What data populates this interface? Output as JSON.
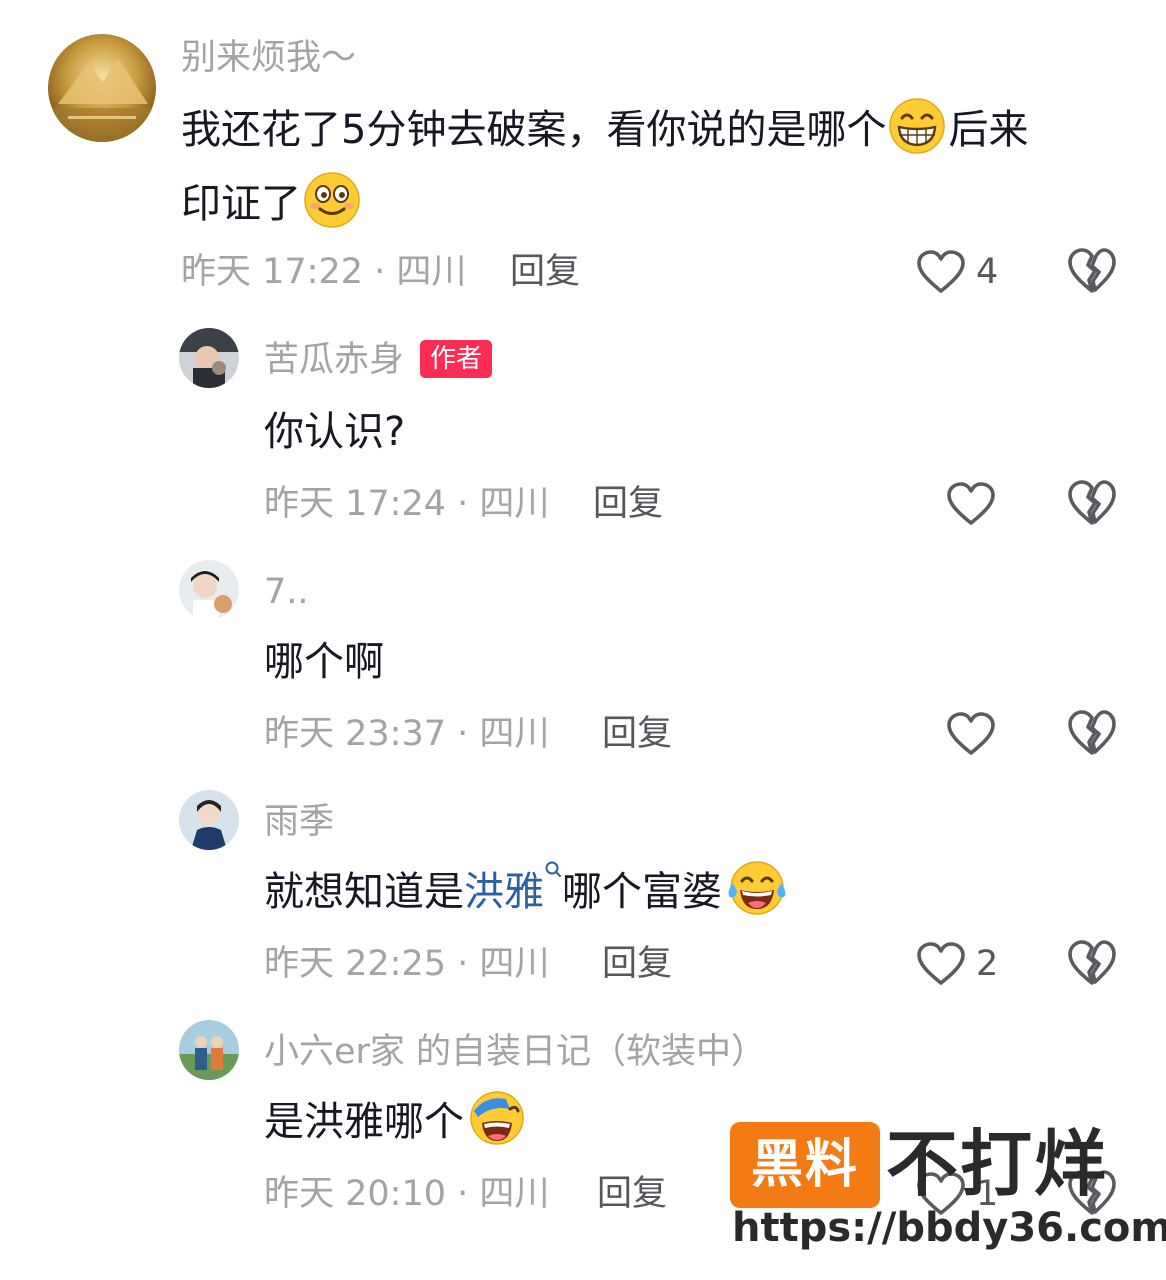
{
  "comments": [
    {
      "nickname": "别来烦我～",
      "text_line1_a": "我还花了5分钟去破案，看你说的是哪个",
      "emoji_1": "grin-emoji",
      "text_line1_b": "后来",
      "text_line2": "印证了",
      "emoji_2": "smile-emoji",
      "meta": "昨天 17:22 · 四川",
      "reply": "回复",
      "likes": "4"
    },
    {
      "nickname": "苦瓜赤身",
      "badge": "作者",
      "text": "你认识?",
      "meta": "昨天 17:24 · 四川",
      "reply": "回复",
      "likes": ""
    },
    {
      "nickname": "7..",
      "text": "哪个啊",
      "meta": "昨天 23:37 · 四川",
      "reply": "回复",
      "likes": ""
    },
    {
      "nickname": "雨季",
      "text_a": "就想知道是",
      "link": "洪雅",
      "text_b": "哪个富婆",
      "emoji": "tears-of-joy-emoji",
      "meta": "昨天 22:25 · 四川",
      "reply": "回复",
      "likes": "2"
    },
    {
      "nickname": "小六er家 的自装日记（软装中）",
      "text": "是洪雅哪个",
      "emoji": "loudly-crying-emoji",
      "meta": "昨天 20:10 · 四川",
      "reply": "回复",
      "likes": "1"
    }
  ],
  "watermark": {
    "box": "黑料",
    "text": "不打烊",
    "url": "https://bbdy36.com"
  },
  "colors": {
    "nickname": "#a3a3a8",
    "body": "#161823",
    "badge": "#fe2c55",
    "link": "#2b5fa6",
    "watermark_box": "#f47a14"
  }
}
